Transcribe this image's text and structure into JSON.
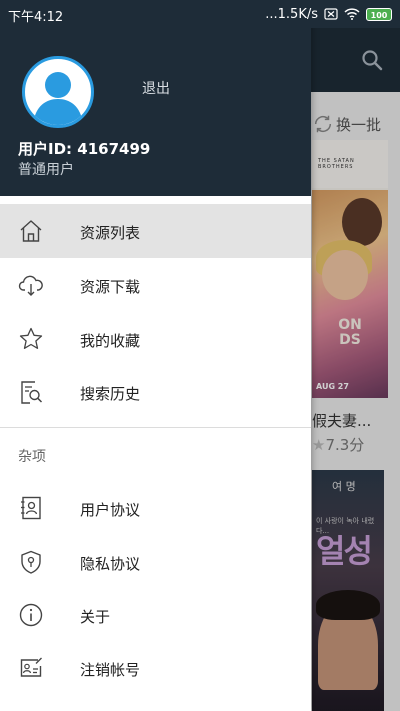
{
  "status_bar": {
    "time": "下午4:12",
    "network_speed": "...1.5K/s",
    "battery": "100"
  },
  "background": {
    "refresh_label": "换一批",
    "poster1_top_text": "THE SATAN BROTHERS",
    "poster1_title_text": "ON\nDS",
    "poster1_date": "AUG 27",
    "movie1_title": "假夫妻...",
    "movie1_rating": "7.3分",
    "poster2_header": "여 명",
    "poster2_sub": "이 사랑이 녹아 내렸다...",
    "poster2_title": "얼성"
  },
  "drawer": {
    "logout_label": "退出",
    "user_id": "用户ID: 4167499",
    "user_role": "普通用户",
    "menu": [
      {
        "label": "资源列表",
        "icon": "home-icon",
        "active": true
      },
      {
        "label": "资源下载",
        "icon": "cloud-download-icon",
        "active": false
      },
      {
        "label": "我的收藏",
        "icon": "star-icon",
        "active": false
      },
      {
        "label": "搜索历史",
        "icon": "search-history-icon",
        "active": false
      }
    ],
    "misc_section_label": "杂项",
    "misc_menu": [
      {
        "label": "用户协议",
        "icon": "user-agreement-icon"
      },
      {
        "label": "隐私协议",
        "icon": "privacy-shield-icon"
      },
      {
        "label": "关于",
        "icon": "info-icon"
      },
      {
        "label": "注销帐号",
        "icon": "account-card-icon"
      }
    ]
  },
  "colors": {
    "header_bg": "#1e2c38",
    "avatar_accent": "#2a9be0",
    "active_item_bg": "#e3e3e3"
  }
}
